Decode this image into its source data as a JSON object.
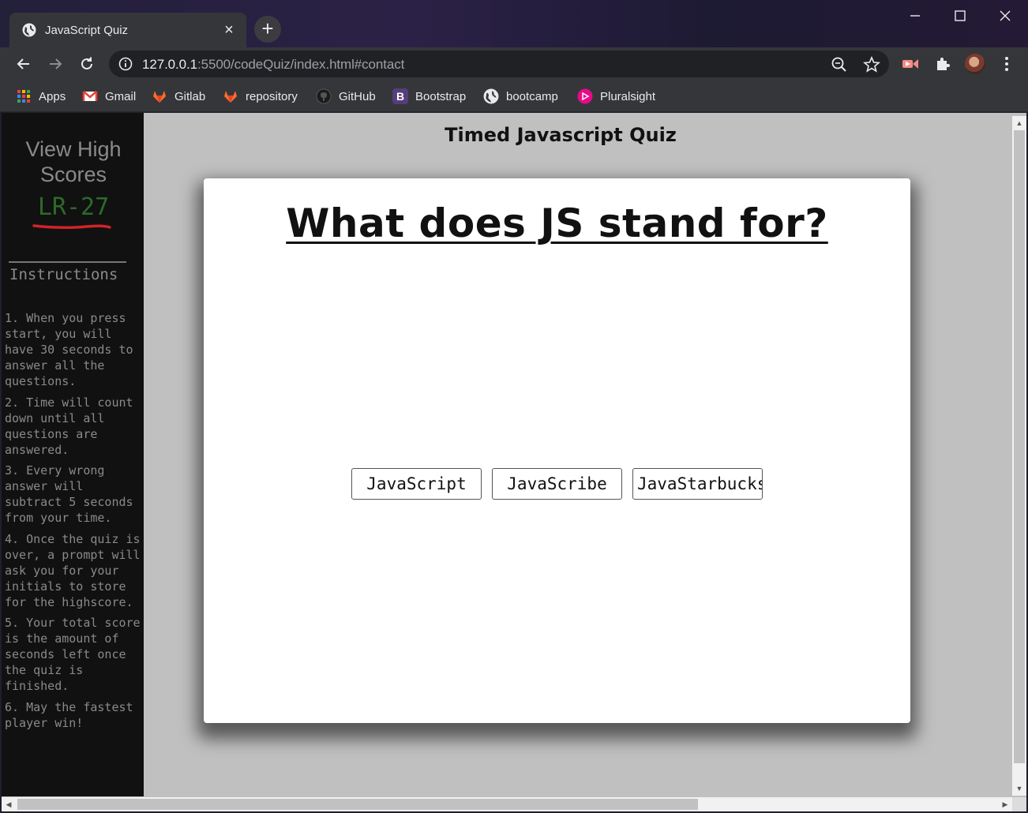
{
  "browser": {
    "tab_title": "JavaScript Quiz",
    "tab_close": "×",
    "new_tab": "+",
    "url_host": "127.0.0.1",
    "url_rest": ":5500/codeQuiz/index.html#contact"
  },
  "bookmarks": [
    {
      "label": "Apps",
      "icon": "apps-grid-icon"
    },
    {
      "label": "Gmail",
      "icon": "gmail-icon"
    },
    {
      "label": "Gitlab",
      "icon": "gitlab-icon"
    },
    {
      "label": "repository",
      "icon": "gitlab-icon"
    },
    {
      "label": "GitHub",
      "icon": "github-icon"
    },
    {
      "label": "Bootstrap",
      "icon": "bootstrap-icon"
    },
    {
      "label": "bootcamp",
      "icon": "globe-icon"
    },
    {
      "label": "Pluralsight",
      "icon": "pluralsight-icon"
    }
  ],
  "sidebar": {
    "view_high_scores": "View High Scores",
    "timer": "LR-27",
    "instructions_title": "Instructions",
    "instructions": [
      "1. When you press start, you will have 30 seconds to answer all the questions.",
      "2. Time will count down until all questions are answered.",
      "3. Every wrong answer will subtract 5 seconds from your time.",
      "4. Once the quiz is over, a prompt will ask you for your initials to store for the highscore.",
      "5. Your total score is the amount of seconds left once the quiz is finished.",
      "6. May the fastest player win!"
    ]
  },
  "main": {
    "heading": "Timed Javascript Quiz",
    "question": "What does JS stand for?",
    "answers": [
      "JavaScript",
      "JavaScribe",
      "JavaStarbucks"
    ]
  },
  "colors": {
    "sidebar_bg": "#111111",
    "timer": "#2d6a2a",
    "underline_mark": "#d0232a",
    "page_bg": "#c0c0c0"
  }
}
